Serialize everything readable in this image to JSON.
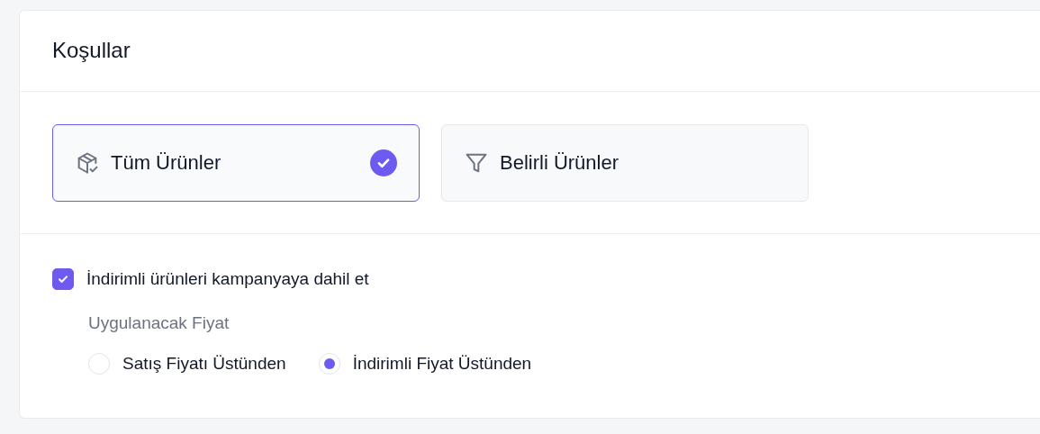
{
  "title": "Koşullar",
  "scope_options": [
    {
      "label": "Tüm Ürünler",
      "selected": true
    },
    {
      "label": "Belirli Ürünler",
      "selected": false
    }
  ],
  "include_discounted": {
    "label": "İndirimli ürünleri kampanyaya dahil et",
    "checked": true
  },
  "price_basis": {
    "label": "Uygulanacak Fiyat",
    "options": [
      {
        "label": "Satış Fiyatı Üstünden",
        "selected": false
      },
      {
        "label": "İndirimli Fiyat Üstünden",
        "selected": true
      }
    ]
  }
}
